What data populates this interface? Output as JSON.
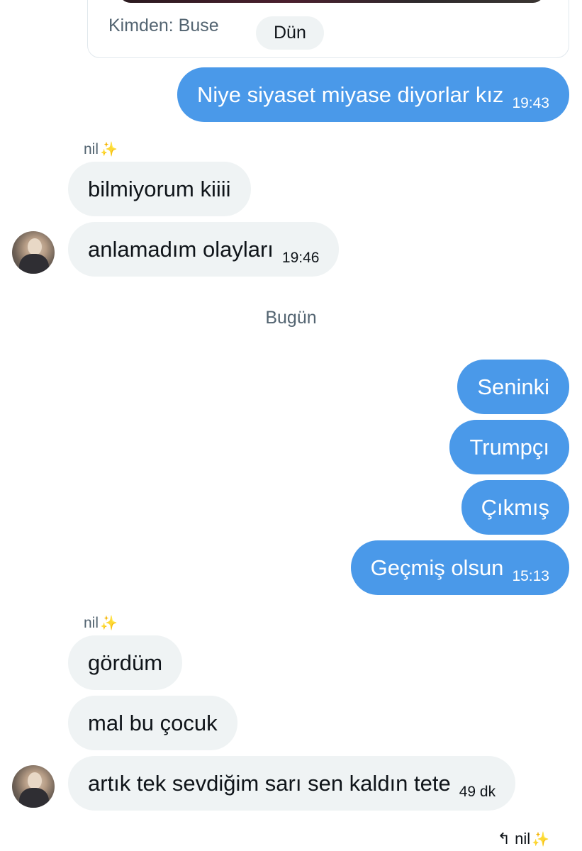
{
  "quoted": {
    "from_label": "Kimden: Buse",
    "day_label": "Dün"
  },
  "messages": {
    "m1": {
      "text": "Niye siyaset miyase diyorlar kız",
      "time": "19:43"
    },
    "sender1": {
      "name": "nil",
      "emoji": "✨"
    },
    "m2": {
      "text": "bilmiyorum kiiii"
    },
    "m3": {
      "text": "anlamadım olayları",
      "time": "19:46"
    },
    "today_label": "Bugün",
    "m4": {
      "text": "Seninki"
    },
    "m5": {
      "text": "Trumpçı"
    },
    "m6": {
      "text": "Çıkmış"
    },
    "m7": {
      "text": "Geçmiş olsun",
      "time": "15:13"
    },
    "sender2": {
      "name": "nil",
      "emoji": "✨"
    },
    "m8": {
      "text": "gördüm"
    },
    "m9": {
      "text": "mal bu çocuk"
    },
    "m10": {
      "text": "artık tek sevdiğim sarı sen kaldın tete",
      "time": "49 dk"
    }
  },
  "reply": {
    "icon": "reply-arrow-icon",
    "glyph": "↰",
    "name": "nil",
    "emoji": "✨"
  },
  "colors": {
    "outgoing_bubble": "#4a99e9",
    "incoming_bubble": "#eff3f4",
    "muted_text": "#536471",
    "sparkle": "#f7c948"
  }
}
